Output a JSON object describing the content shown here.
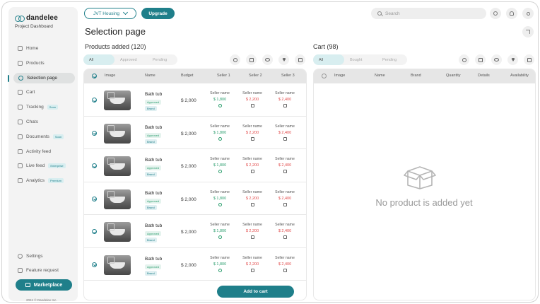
{
  "brand": {
    "name": "dandelee",
    "subtitle": "Project Dashboard"
  },
  "nav": [
    {
      "label": "Home",
      "icon": "home-icon"
    },
    {
      "label": "Products",
      "icon": "products-icon"
    },
    {
      "label": "Selection page",
      "icon": "selection-icon",
      "active": true
    },
    {
      "label": "Cart",
      "icon": "cart-icon"
    },
    {
      "label": "Tracking",
      "icon": "tracking-icon",
      "tag": "Soon"
    },
    {
      "label": "Chats",
      "icon": "chat-icon"
    },
    {
      "label": "Documents",
      "icon": "documents-icon",
      "tag": "Soon"
    },
    {
      "label": "Activity feed",
      "icon": "activity-icon"
    },
    {
      "label": "Live feed",
      "icon": "live-icon",
      "tag": "Enterprise"
    },
    {
      "label": "Analytics",
      "icon": "analytics-icon",
      "tag": "Premium"
    }
  ],
  "bottom_nav": [
    {
      "label": "Settings",
      "icon": "gear-icon"
    },
    {
      "label": "Feature request",
      "icon": "feature-request-icon"
    }
  ],
  "marketplace": "Marketplace",
  "copyright": "2024 © Dandelee Inc.",
  "header": {
    "project_select": "JVT Housing",
    "upgrade": "Upgrade",
    "search_placeholder": "Search"
  },
  "page": {
    "title": "Selection page",
    "products_title": "Products added (120)",
    "cart_title": "Cart (98)"
  },
  "product_filters": [
    "All",
    "Approved",
    "Pending"
  ],
  "cart_filters": [
    "All",
    "Bought",
    "Pending"
  ],
  "product_columns": [
    "Image",
    "Name",
    "Budget",
    "Seller 1",
    "Seller 2",
    "Seller 3"
  ],
  "cart_columns": [
    "Image",
    "Name",
    "Brand",
    "Quantity",
    "Details",
    "Availability"
  ],
  "rows": [
    {
      "name": "Bath tub",
      "badge1": "Approved",
      "badge2": "Brand",
      "budget": "$ 2,000",
      "sellers": [
        {
          "name": "Seller name",
          "price": "$ 1,800"
        },
        {
          "name": "Seller name",
          "price": "$ 2,200"
        },
        {
          "name": "Seller name",
          "price": "$ 2,400"
        }
      ]
    },
    {
      "name": "Bath tub",
      "badge1": "Approved",
      "badge2": "Brand",
      "budget": "$ 2,000",
      "sellers": [
        {
          "name": "Seller name",
          "price": "$ 1,800"
        },
        {
          "name": "Seller name",
          "price": "$ 2,200"
        },
        {
          "name": "Seller name",
          "price": "$ 2,400"
        }
      ]
    },
    {
      "name": "Bath tub",
      "badge1": "Approved",
      "badge2": "Brand",
      "budget": "$ 2,000",
      "sellers": [
        {
          "name": "Seller name",
          "price": "$ 1,800"
        },
        {
          "name": "Seller name",
          "price": "$ 2,200"
        },
        {
          "name": "Seller name",
          "price": "$ 2,400"
        }
      ]
    },
    {
      "name": "Bath tub",
      "badge1": "Approved",
      "badge2": "Brand",
      "budget": "$ 2,000",
      "sellers": [
        {
          "name": "Seller name",
          "price": "$ 1,800"
        },
        {
          "name": "Seller name",
          "price": "$ 2,200"
        },
        {
          "name": "Seller name",
          "price": "$ 2,400"
        }
      ]
    },
    {
      "name": "Bath tub",
      "badge1": "Approved",
      "badge2": "Brand",
      "budget": "$ 2,000",
      "sellers": [
        {
          "name": "Seller name",
          "price": "$ 1,800"
        },
        {
          "name": "Seller name",
          "price": "$ 2,200"
        },
        {
          "name": "Seller name",
          "price": "$ 2,400"
        }
      ]
    },
    {
      "name": "Bath tub",
      "badge1": "Approved",
      "badge2": "Brand",
      "budget": "$ 2,000",
      "sellers": [
        {
          "name": "Seller name",
          "price": "$ 1,800"
        },
        {
          "name": "Seller name",
          "price": "$ 2,200"
        },
        {
          "name": "Seller name",
          "price": "$ 2,400"
        }
      ]
    }
  ],
  "add_to_cart": "Add to cart",
  "cart_empty": "No product is added yet",
  "colors": {
    "accent": "#1f7f8a",
    "approved": "#2a9d6d",
    "price_high": "#e24a4a"
  }
}
